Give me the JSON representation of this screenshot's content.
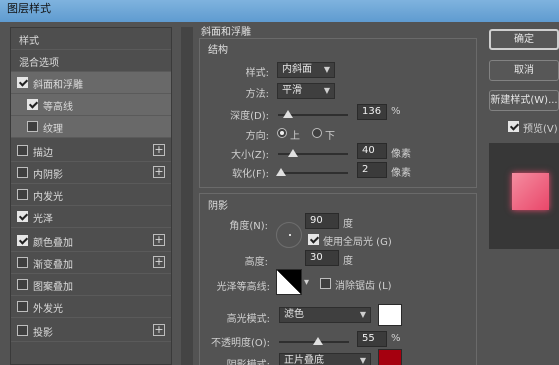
{
  "window": {
    "title": "图层样式"
  },
  "sidebar": {
    "header": "样式",
    "items": [
      {
        "label": "混合选项",
        "checkbox": null,
        "plus": false,
        "selected": false
      },
      {
        "label": "斜面和浮雕",
        "checkbox": true,
        "plus": false,
        "selected": true
      },
      {
        "label": "等高线",
        "checkbox": true,
        "plus": false,
        "selected": false,
        "indent": true
      },
      {
        "label": "纹理",
        "checkbox": false,
        "plus": false,
        "selected": false,
        "indent": true
      },
      {
        "label": "描边",
        "checkbox": false,
        "plus": true,
        "selected": false
      },
      {
        "label": "内阴影",
        "checkbox": false,
        "plus": true,
        "selected": false
      },
      {
        "label": "内发光",
        "checkbox": false,
        "plus": false,
        "selected": false
      },
      {
        "label": "光泽",
        "checkbox": true,
        "plus": false,
        "selected": false
      },
      {
        "label": "颜色叠加",
        "checkbox": true,
        "plus": true,
        "selected": false
      },
      {
        "label": "渐变叠加",
        "checkbox": false,
        "plus": true,
        "selected": false
      },
      {
        "label": "图案叠加",
        "checkbox": false,
        "plus": false,
        "selected": false
      },
      {
        "label": "外发光",
        "checkbox": false,
        "plus": false,
        "selected": false
      },
      {
        "label": "投影",
        "checkbox": false,
        "plus": true,
        "selected": false
      }
    ]
  },
  "bevel": {
    "title": "斜面和浮雕",
    "structure_title": "结构",
    "style_label": "样式:",
    "style_value": "内斜面",
    "technique_label": "方法:",
    "technique_value": "平滑",
    "depth_label": "深度(D):",
    "depth_value": "136",
    "depth_unit": "%",
    "direction_label": "方向:",
    "direction_up": "上",
    "direction_down": "下",
    "size_label": "大小(Z):",
    "size_value": "40",
    "size_unit": "像素",
    "soften_label": "软化(F):",
    "soften_value": "2",
    "soften_unit": "像素"
  },
  "shading": {
    "title": "阴影",
    "angle_label": "角度(N):",
    "angle_value": "90",
    "angle_unit": "度",
    "global_light_label": "使用全局光 (G)",
    "global_light_checked": true,
    "altitude_label": "高度:",
    "altitude_value": "30",
    "altitude_unit": "度",
    "gloss_label": "光泽等高线:",
    "anti_alias_label": "消除锯齿 (L)",
    "anti_alias_checked": false,
    "highlight_mode_label": "高光模式:",
    "highlight_mode_value": "滤色",
    "highlight_color": "#ffffff",
    "opacity_label": "不透明度(O):",
    "opacity_value": "55",
    "opacity_unit": "%",
    "shadow_mode_label": "阴影模式:",
    "shadow_mode_value": "正片叠底",
    "shadow_color": "#a5000f"
  },
  "buttons": {
    "ok": "确定",
    "cancel": "取消",
    "new_style": "新建样式(W)...",
    "preview_label": "预览(V)",
    "preview_checked": true
  },
  "colors": {
    "accent_preview": "#e9476a",
    "panel_bg": "#535353"
  }
}
